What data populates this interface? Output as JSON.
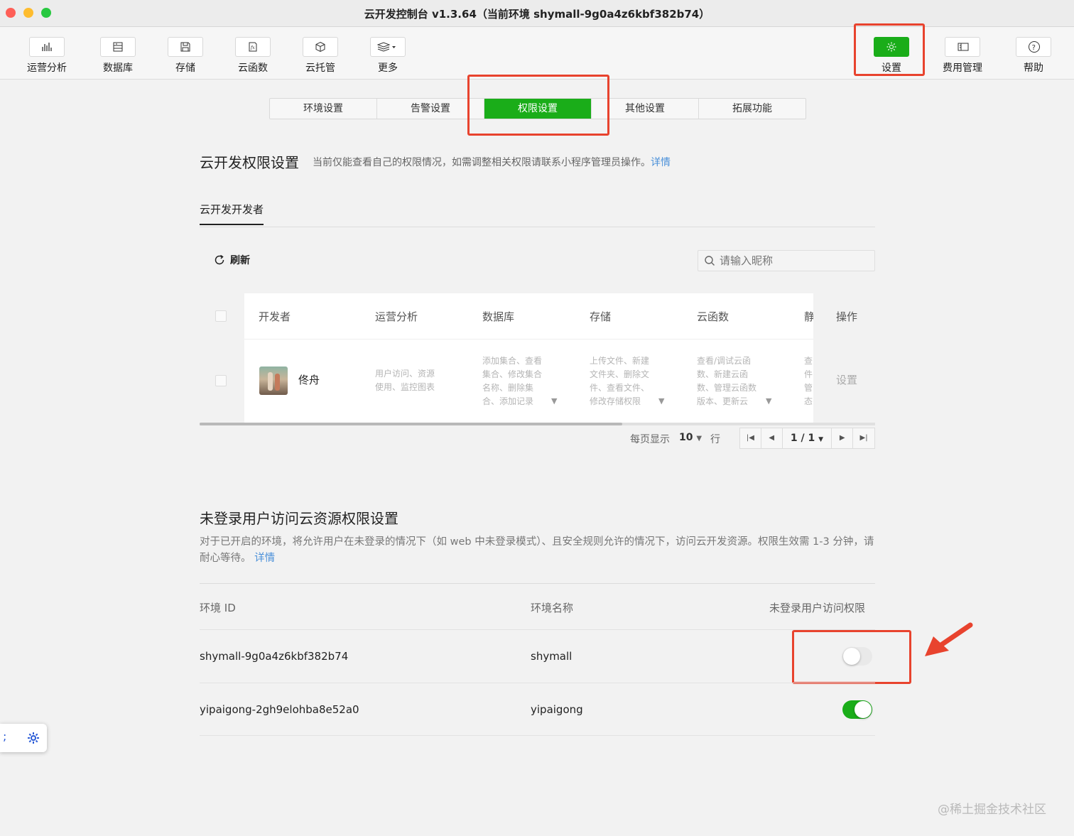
{
  "window": {
    "title": "云开发控制台 v1.3.64（当前环境 shymall-9g0a4z6kbf382b74）"
  },
  "toolbar": {
    "items": [
      {
        "label": "运营分析",
        "icon": "bar-chart-icon"
      },
      {
        "label": "数据库",
        "icon": "database-icon"
      },
      {
        "label": "存储",
        "icon": "save-icon"
      },
      {
        "label": "云函数",
        "icon": "function-icon"
      },
      {
        "label": "云托管",
        "icon": "cube-icon"
      },
      {
        "label": "更多",
        "icon": "layers-icon"
      }
    ],
    "right_items": [
      {
        "label": "设置",
        "icon": "gear-icon"
      },
      {
        "label": "费用管理",
        "icon": "billing-icon"
      },
      {
        "label": "帮助",
        "icon": "help-icon"
      }
    ]
  },
  "subtabs": [
    "环境设置",
    "告警设置",
    "权限设置",
    "其他设置",
    "拓展功能"
  ],
  "permission": {
    "title": "云开发权限设置",
    "desc": "当前仅能查看自己的权限情况，如需调整相关权限请联系小程序管理员操作。",
    "desc_link": "详情",
    "tab": "云开发开发者",
    "refresh": "刷新",
    "search_placeholder": "请输入昵称"
  },
  "dev_table": {
    "headers": [
      "开发者",
      "运营分析",
      "数据库",
      "存储",
      "云函数",
      "静",
      "操作"
    ],
    "row": {
      "name": "佟舟",
      "ops": "用户访问、资源\n使用、监控图表",
      "db": "添加集合、查看\n集合、修改集合\n名称、删除集\n合、添加记录",
      "storage": "上传文件、新建\n文件夹、删除文\n件、查看文件、\n修改存储权限",
      "func": "查看/调试云函\n数、新建云函\n数、管理云函数\n版本、更新云",
      "static": "查\n件\n管\n态",
      "action": "设置"
    }
  },
  "pager": {
    "per_page_label": "每页显示",
    "per_page": "10",
    "unit": "行",
    "page": "1 / 1"
  },
  "unlogged": {
    "title": "未登录用户访问云资源权限设置",
    "desc": "对于已开启的环境，将允许用户在未登录的情况下（如 web 中未登录模式）、且安全规则允许的情况下，访问云开发资源。权限生效需 1-3 分钟，请耐心等待。",
    "desc_link": "详情",
    "headers": [
      "环境 ID",
      "环境名称",
      "未登录用户访问权限"
    ],
    "rows": [
      {
        "id": "shymall-9g0a4z6kbf382b74",
        "name": "shymall",
        "enabled": false
      },
      {
        "id": "yipaigong-2gh9elohba8e52a0",
        "name": "yipaigong",
        "enabled": true
      }
    ]
  },
  "floating": {
    "text": ";"
  },
  "watermark": "@稀土掘金技术社区",
  "colors": {
    "accent": "#1aad19",
    "highlight": "#e8432e",
    "link": "#4a90d9"
  }
}
